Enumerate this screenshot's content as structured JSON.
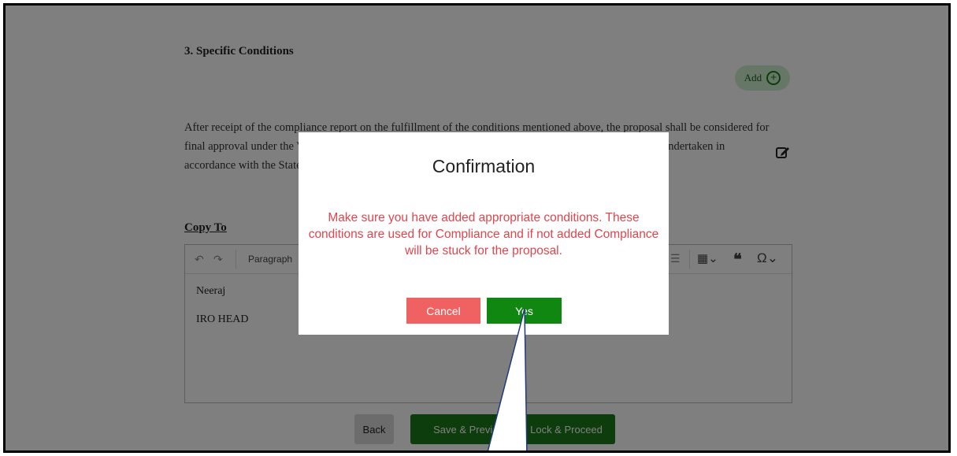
{
  "page": {
    "section_title": "3. Specific Conditions",
    "add_label": "Add",
    "condition_text": "After receipt of the compliance report on the fulfillment of the conditions mentioned above, the proposal shall be considered for final approval under the Van (Sanrakshan Evam Samvardhan) Act, 1980. Transfer of forest land shall be undertaken in accordance with the State Government in this regard.",
    "copy_to_label": "Copy To",
    "editor": {
      "block_format": "Paragraph",
      "lines": [
        "Neeraj",
        "IRO HEAD"
      ]
    },
    "buttons": {
      "back": "Back",
      "save_preview": "Save & Preview",
      "lock_proceed": "Lock & Proceed"
    }
  },
  "modal": {
    "title": "Confirmation",
    "message": "Make sure you have added appropriate conditions. These conditions are used for Compliance and if not added Compliance will be stuck for the proposal.",
    "cancel_label": "Cancel",
    "yes_label": "Yes"
  },
  "colors": {
    "accent_green": "#108710",
    "warning_red": "#e0454e",
    "cancel_red": "#f06262",
    "callout_blue": "#1f3c78"
  },
  "icons": [
    "undo-icon",
    "redo-icon",
    "outdent-icon",
    "table-icon",
    "blockquote-icon",
    "special-characters-icon",
    "edit-icon",
    "plus-circle-icon"
  ]
}
